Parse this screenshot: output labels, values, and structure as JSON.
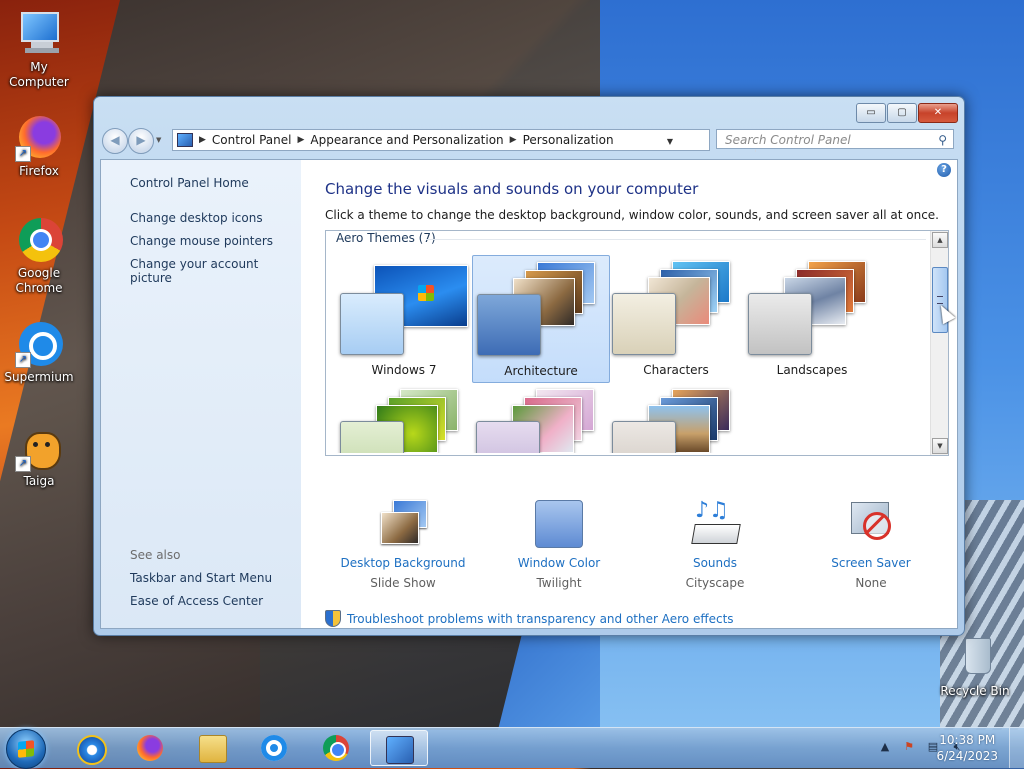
{
  "desktop": {
    "icons": [
      {
        "label": "My Computer",
        "icon": "computer-icon"
      },
      {
        "label": "Firefox",
        "icon": "firefox-icon"
      },
      {
        "label": "Google Chrome",
        "icon": "chrome-icon"
      },
      {
        "label": "Supermium",
        "icon": "supermium-icon"
      },
      {
        "label": "Taiga",
        "icon": "taiga-cat-icon"
      },
      {
        "label": "Recycle Bin",
        "icon": "recycle-bin-icon"
      }
    ]
  },
  "window": {
    "breadcrumb": [
      "Control Panel",
      "Appearance and Personalization",
      "Personalization"
    ],
    "search_placeholder": "Search Control Panel",
    "help_glyph": "?",
    "controls": {
      "minimize": "▭",
      "maximize": "▢",
      "close": "✕"
    }
  },
  "sidebar": {
    "home": "Control Panel Home",
    "links": [
      "Change desktop icons",
      "Change mouse pointers",
      "Change your account picture"
    ],
    "see_also_label": "See also",
    "see_also": [
      "Taskbar and Start Menu",
      "Ease of Access Center"
    ]
  },
  "main": {
    "title": "Change the visuals and sounds on your computer",
    "description": "Click a theme to change the desktop background, window color, sounds, and screen saver all at once.",
    "group_label": "Aero Themes (7)",
    "themes": [
      {
        "name": "Windows 7",
        "selected": false
      },
      {
        "name": "Architecture",
        "selected": true
      },
      {
        "name": "Characters",
        "selected": false
      },
      {
        "name": "Landscapes",
        "selected": false
      },
      {
        "name": "",
        "selected": false
      },
      {
        "name": "",
        "selected": false
      },
      {
        "name": "",
        "selected": false
      }
    ],
    "settings": [
      {
        "label": "Desktop Background",
        "value": "Slide Show",
        "icon": "desktop-background-icon"
      },
      {
        "label": "Window Color",
        "value": "Twilight",
        "icon": "window-color-icon"
      },
      {
        "label": "Sounds",
        "value": "Cityscape",
        "icon": "sounds-icon"
      },
      {
        "label": "Screen Saver",
        "value": "None",
        "icon": "screen-saver-icon"
      }
    ],
    "troubleshoot_link": "Troubleshoot problems with transparency and other Aero effects"
  },
  "taskbar": {
    "pinned": [
      "internet-explorer-icon",
      "firefox-icon",
      "file-explorer-icon",
      "supermium-icon",
      "chrome-icon",
      "control-panel-icon"
    ],
    "active_index": 5,
    "clock_time": "10:38 PM",
    "clock_date": "6/24/2023"
  }
}
